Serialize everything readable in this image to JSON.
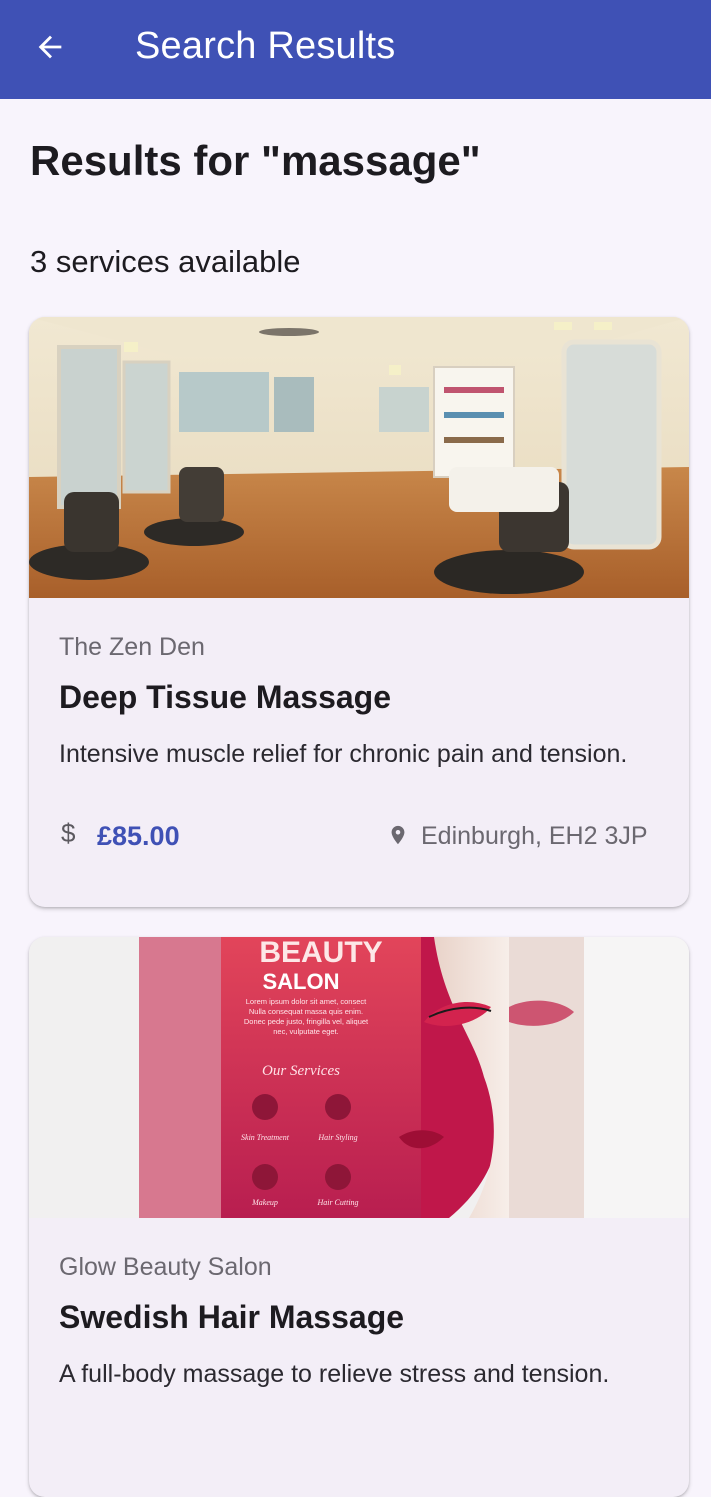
{
  "appbar": {
    "title": "Search Results",
    "back_icon": "arrow-back-icon"
  },
  "page": {
    "heading": "Results for \"massage\"",
    "count_text": "3 services available"
  },
  "results": [
    {
      "image": "salon-interior-photo",
      "provider": "The Zen Den",
      "name": "Deep Tissue Massage",
      "description": "Intensive muscle relief for chronic pain and tension.",
      "price": "£85.00",
      "location": "Edinburgh, EH2 3JP"
    },
    {
      "image": "beauty-salon-flyer-photo",
      "provider": "Glow Beauty Salon",
      "name": "Swedish Hair Massage",
      "description": "A full-body massage to relieve stress and tension."
    }
  ],
  "flyer": {
    "title_line1": "BEAUTY",
    "title_line2": "SALON",
    "blurb": "Lorem ipsum dolor sit amet, consect Nulla consequat massa quis enim. Donec pede justo, fringilla vel, aliquet nec, vulputate eget.",
    "services_heading": "Our Services",
    "services": [
      "Skin Treatment",
      "Hair Styling",
      "Makeup",
      "Hair Cutting"
    ]
  },
  "colors": {
    "primary": "#3f51b5",
    "background": "#f8f4fc",
    "card": "#f3eef7"
  }
}
